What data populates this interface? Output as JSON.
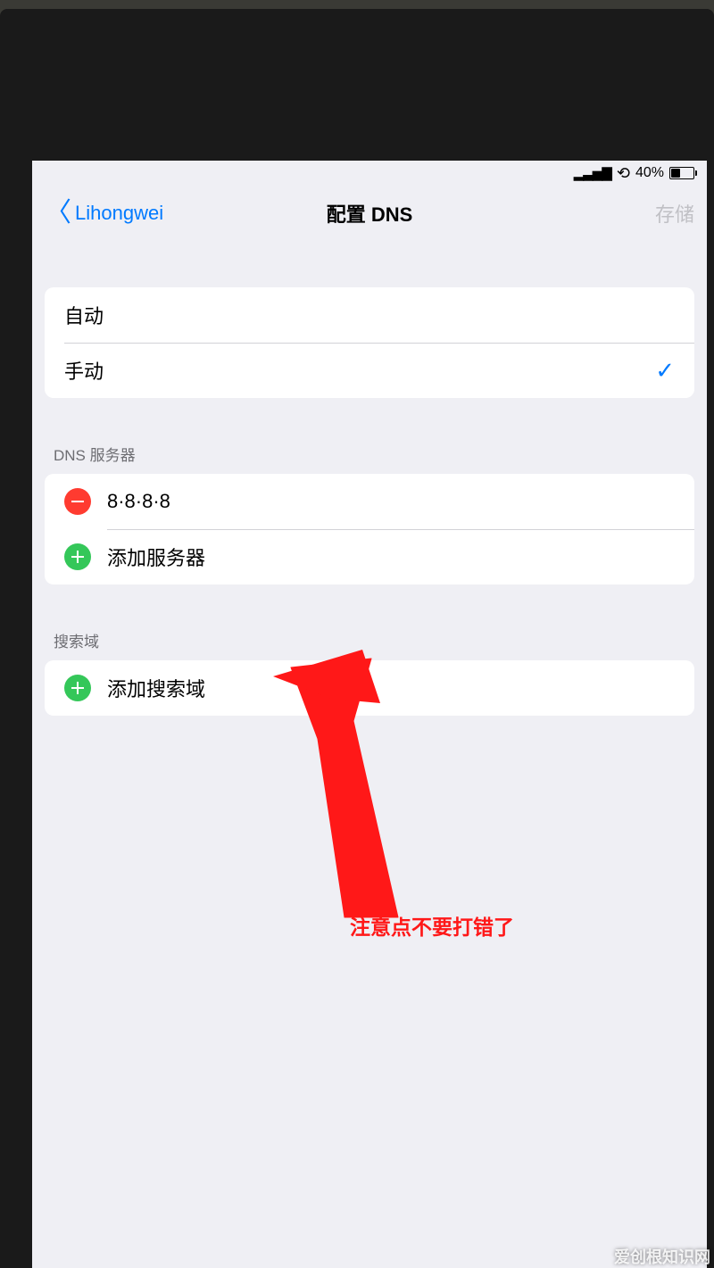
{
  "status_bar": {
    "battery_percent": "40%"
  },
  "nav": {
    "back_label": "Lihongwei",
    "title": "配置 DNS",
    "save_label": "存储"
  },
  "mode": {
    "auto": "自动",
    "manual": "手动"
  },
  "dns": {
    "section_header": "DNS 服务器",
    "server_value": "8·8·8·8",
    "add_server": "添加服务器"
  },
  "search": {
    "section_header": "搜索域",
    "add_domain": "添加搜索域"
  },
  "annotation": {
    "text": "注意点不要打错了"
  },
  "watermark": "爱创根知识网"
}
